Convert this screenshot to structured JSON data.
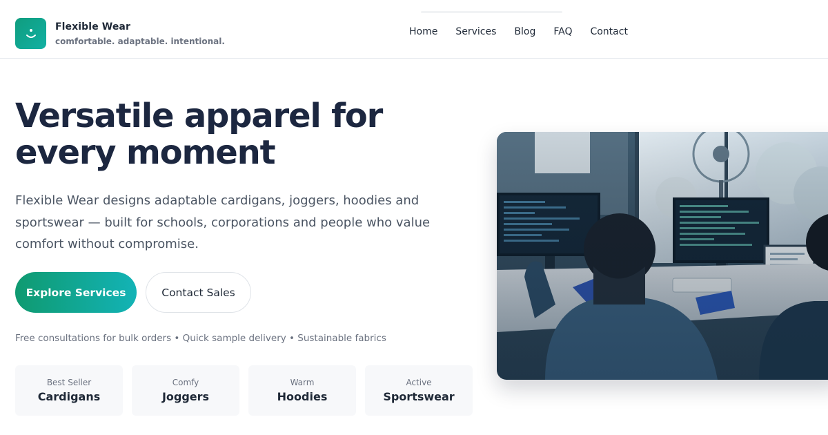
{
  "brand": {
    "name": "Flexible Wear",
    "tagline": "comfortable. adaptable. intentional.",
    "logo_icon": "person-smile-icon",
    "accent_color": "#12a58e"
  },
  "nav": {
    "items": [
      {
        "label": "Home"
      },
      {
        "label": "Services"
      },
      {
        "label": "Blog"
      },
      {
        "label": "FAQ"
      },
      {
        "label": "Contact"
      }
    ]
  },
  "hero": {
    "title": "Versatile apparel for every moment",
    "description": "Flexible Wear designs adaptable cardigans, joggers, hoodies and sportswear — built for schools, corporations and people who value comfort without compromise.",
    "primary_button": "Explore Services",
    "secondary_button": "Contact Sales",
    "perks": "Free consultations for bulk orders • Quick sample delivery • Sustainable fabrics",
    "categories": [
      {
        "kicker": "Best Seller",
        "name": "Cardigans"
      },
      {
        "kicker": "Comfy",
        "name": "Joggers"
      },
      {
        "kicker": "Warm",
        "name": "Hoodies"
      },
      {
        "kicker": "Active",
        "name": "Sportswear"
      }
    ],
    "image_alt": "People working at computers in an office"
  },
  "colors": {
    "title": "#1c2740",
    "text": "#4b5563",
    "muted": "#6b7280",
    "button_gradient_start": "#0f9a70",
    "button_gradient_end": "#13b3b6",
    "card_bg": "#f7f8fa"
  }
}
